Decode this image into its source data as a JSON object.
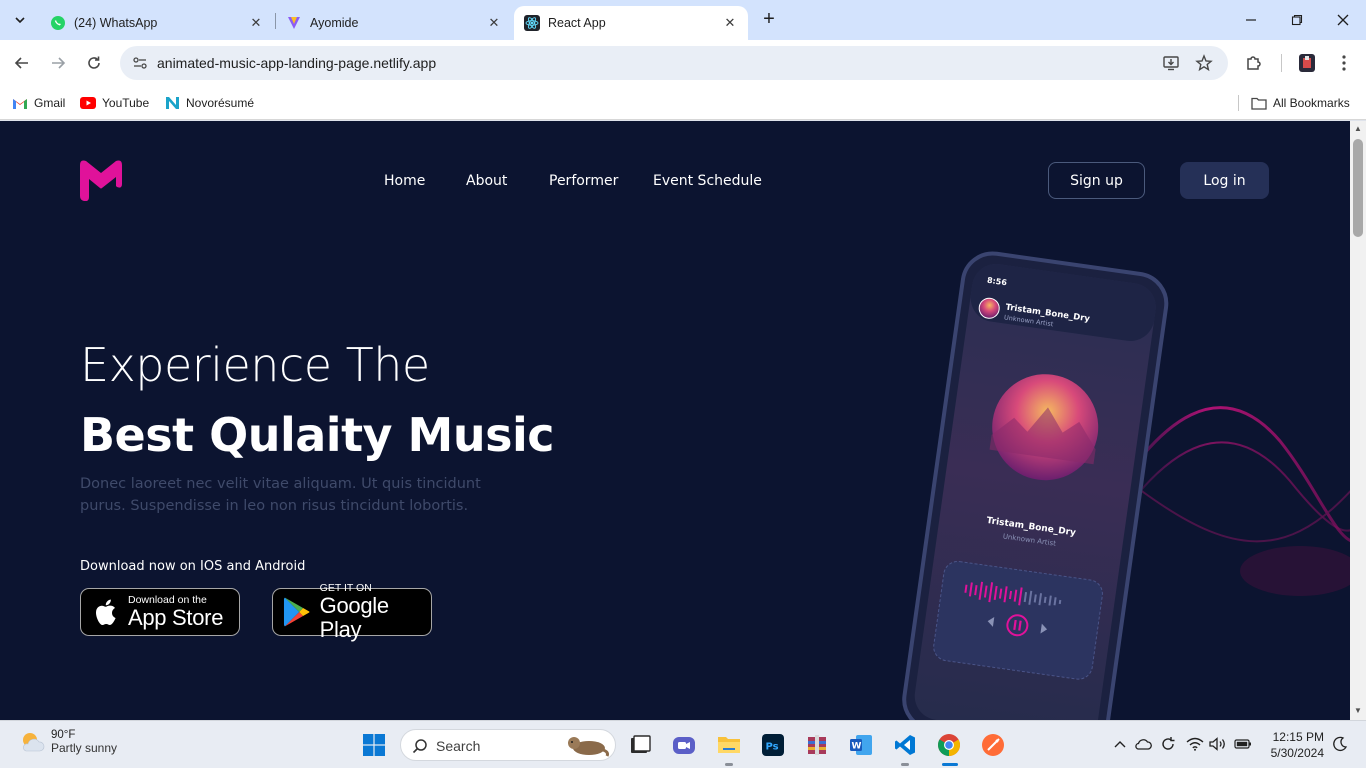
{
  "browser": {
    "tabs": [
      {
        "title": "(24) WhatsApp",
        "favicon": "whatsapp-icon",
        "active": false
      },
      {
        "title": "Ayomide",
        "favicon": "v-logo-icon",
        "active": false
      },
      {
        "title": "React App",
        "favicon": "react-icon",
        "active": true
      }
    ],
    "url": "animated-music-app-landing-page.netlify.app",
    "bookmarks": [
      {
        "label": "Gmail",
        "icon": "gmail-icon"
      },
      {
        "label": "YouTube",
        "icon": "youtube-icon"
      },
      {
        "label": "Novorésumé",
        "icon": "novoresume-icon"
      }
    ],
    "all_bookmarks_label": "All Bookmarks"
  },
  "page": {
    "nav": {
      "home": "Home",
      "about": "About",
      "performer": "Performer",
      "event_schedule": "Event Schedule"
    },
    "signup_label": "Sign up",
    "login_label": "Log in",
    "hero_line1": "Experience The",
    "hero_line2": "Best Qulaity Music",
    "description": "Donec laoreet nec velit vitae aliquam. Ut quis tincidunt purus. Suspendisse in leo non risus tincidunt lobortis.",
    "download_label": "Download now on IOS and Android",
    "app_store": {
      "small": "Download on the",
      "big": "App Store"
    },
    "google_play": {
      "small": "GET IT ON",
      "big": "Google Play"
    },
    "phone": {
      "time": "8:56",
      "track_title": "Tristam_Bone_Dry",
      "artist": "Unknown Artist"
    }
  },
  "taskbar": {
    "weather_temp": "90°F",
    "weather_condition": "Partly sunny",
    "search_label": "Search",
    "time": "12:15 PM",
    "date": "5/30/2024"
  },
  "colors": {
    "page_bg": "#0c1430",
    "logo_magenta": "#e0129a",
    "login_bg": "#253057",
    "tab_strip": "#d3e3fd"
  }
}
